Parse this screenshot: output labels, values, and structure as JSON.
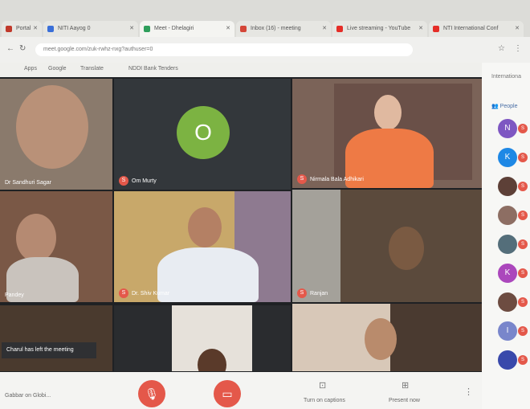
{
  "browser": {
    "tabs": [
      {
        "label": "Portal",
        "color": "#c0392b"
      },
      {
        "label": "NITI Aayog 0",
        "color": "#3a6fd8"
      },
      {
        "label": "Meet - Dhelagiri",
        "color": "#2e9e5b"
      },
      {
        "label": "Inbox (16) - meeting",
        "color": "#d44638"
      },
      {
        "label": "Live streaming - YouTube",
        "color": "#e52d27"
      },
      {
        "label": "NTI International Conf",
        "color": "#e52d27"
      }
    ],
    "url": "meet.google.com/zuk-rwhz-nxg?authuser=0",
    "bookmarks": [
      "Apps",
      "Google",
      "Translate",
      "NDDI Bank Tenders"
    ]
  },
  "tiles": [
    {
      "name": "Dr Sandhuri Sagar",
      "badge": "S"
    },
    {
      "name": "Om Murty",
      "badge": "S",
      "avatar_letter": "O"
    },
    {
      "name": "Nirmala Bala Adhikari",
      "badge": "S"
    },
    {
      "name": "Pandey",
      "badge": ""
    },
    {
      "name": "Dr. Shiv Kumar",
      "badge": "S"
    },
    {
      "name": "Ranjan",
      "badge": "S"
    }
  ],
  "notification": "Charul has left the meeting",
  "controls": {
    "left_text": "Gabbar on Globi...",
    "camera_label": "",
    "cc_label": "Turn on captions",
    "present_label": "Present now"
  },
  "panel": {
    "title": "Internationa",
    "people_label": "People",
    "participants": [
      {
        "letter": "N",
        "color": "#7e57c2"
      },
      {
        "letter": "K",
        "color": "#1e88e5"
      },
      {
        "letter": "",
        "color": "#5d4037"
      },
      {
        "letter": "",
        "color": "#8d6e63"
      },
      {
        "letter": "",
        "color": "#546e7a"
      },
      {
        "letter": "K",
        "color": "#ab47bc"
      },
      {
        "letter": "",
        "color": "#6d4c41"
      },
      {
        "letter": "I",
        "color": "#7986cb"
      },
      {
        "letter": "",
        "color": "#3949ab"
      }
    ]
  },
  "colors": {
    "mute_red": "#e4584a",
    "avatar_green": "#7cb342"
  }
}
